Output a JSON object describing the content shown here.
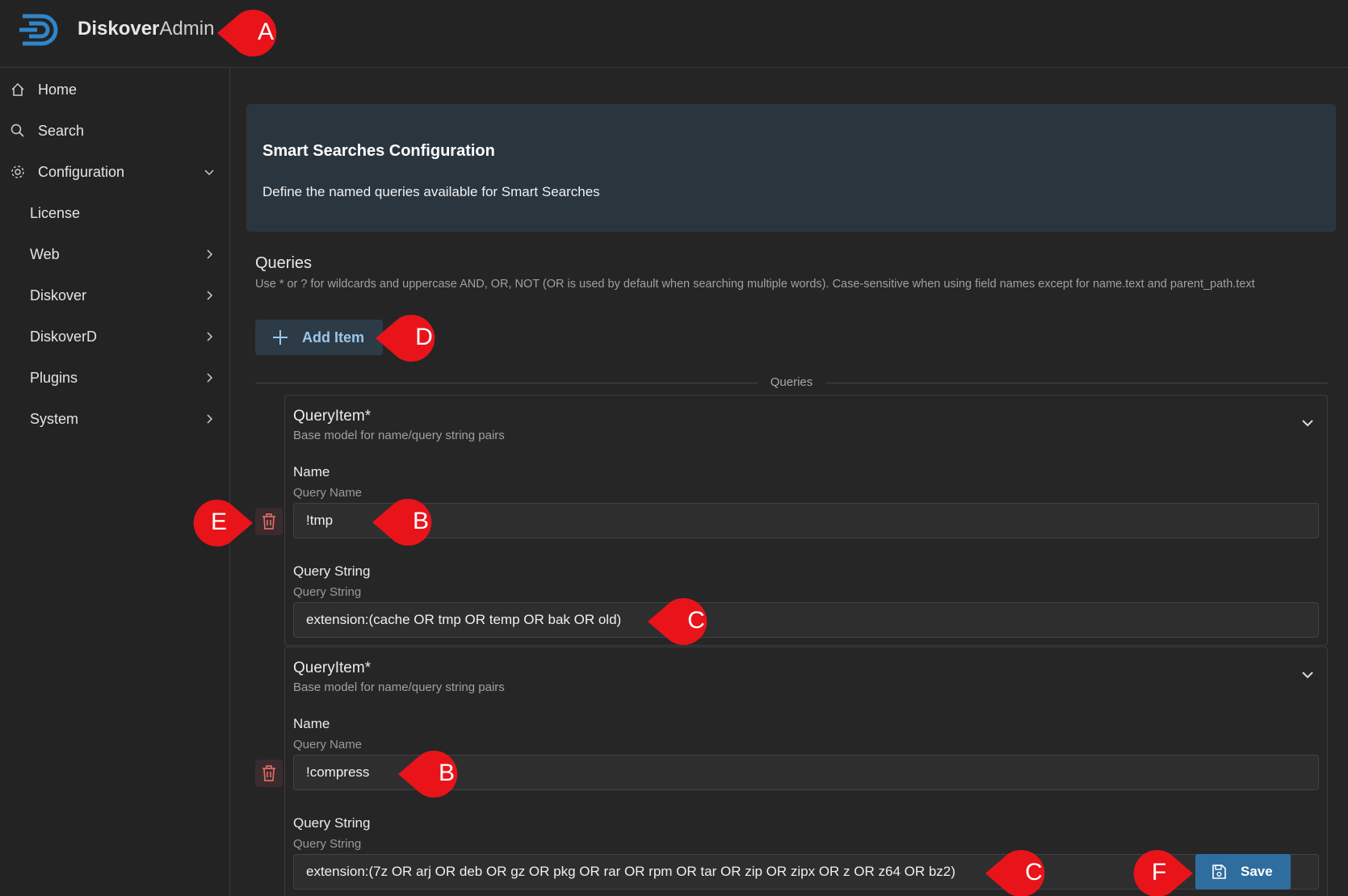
{
  "app": {
    "brand_bold": "Diskover",
    "brand_light": "Admin"
  },
  "sidebar": {
    "items": [
      {
        "label": "Home"
      },
      {
        "label": "Search"
      },
      {
        "label": "Configuration"
      },
      {
        "label": "License"
      },
      {
        "label": "Web"
      },
      {
        "label": "Diskover"
      },
      {
        "label": "DiskoverD"
      },
      {
        "label": "Plugins"
      },
      {
        "label": "System"
      }
    ]
  },
  "banner": {
    "title": "Smart Searches Configuration",
    "description": "Define the named queries available for Smart Searches"
  },
  "queries": {
    "title": "Queries",
    "help": "Use * or ? for wildcards and uppercase AND, OR, NOT (OR is used by default when searching multiple words). Case-sensitive when using field names except for name.text and parent_path.text",
    "add_label": "Add Item",
    "divider_label": "Queries",
    "items": [
      {
        "title": "QueryItem*",
        "subtitle": "Base model for name/query string pairs",
        "name_label": "Name",
        "name_sub": "Query Name",
        "name_value": "!tmp",
        "qs_label": "Query String",
        "qs_sub": "Query String",
        "qs_value": "extension:(cache OR tmp OR temp OR bak OR old)"
      },
      {
        "title": "QueryItem*",
        "subtitle": "Base model for name/query string pairs",
        "name_label": "Name",
        "name_sub": "Query Name",
        "name_value": "!compress",
        "qs_label": "Query String",
        "qs_sub": "Query String",
        "qs_value": "extension:(7z OR arj OR deb OR gz OR pkg OR rar OR rpm OR tar OR zip OR zipx OR z OR z64 OR bz2)"
      }
    ]
  },
  "save_label": "Save",
  "callouts": {
    "a": "A",
    "b": "B",
    "c": "C",
    "d": "D",
    "e": "E",
    "f": "F"
  },
  "colors": {
    "callout": "#e8141a",
    "accent": "#2e6e9e",
    "background": "#252526"
  }
}
